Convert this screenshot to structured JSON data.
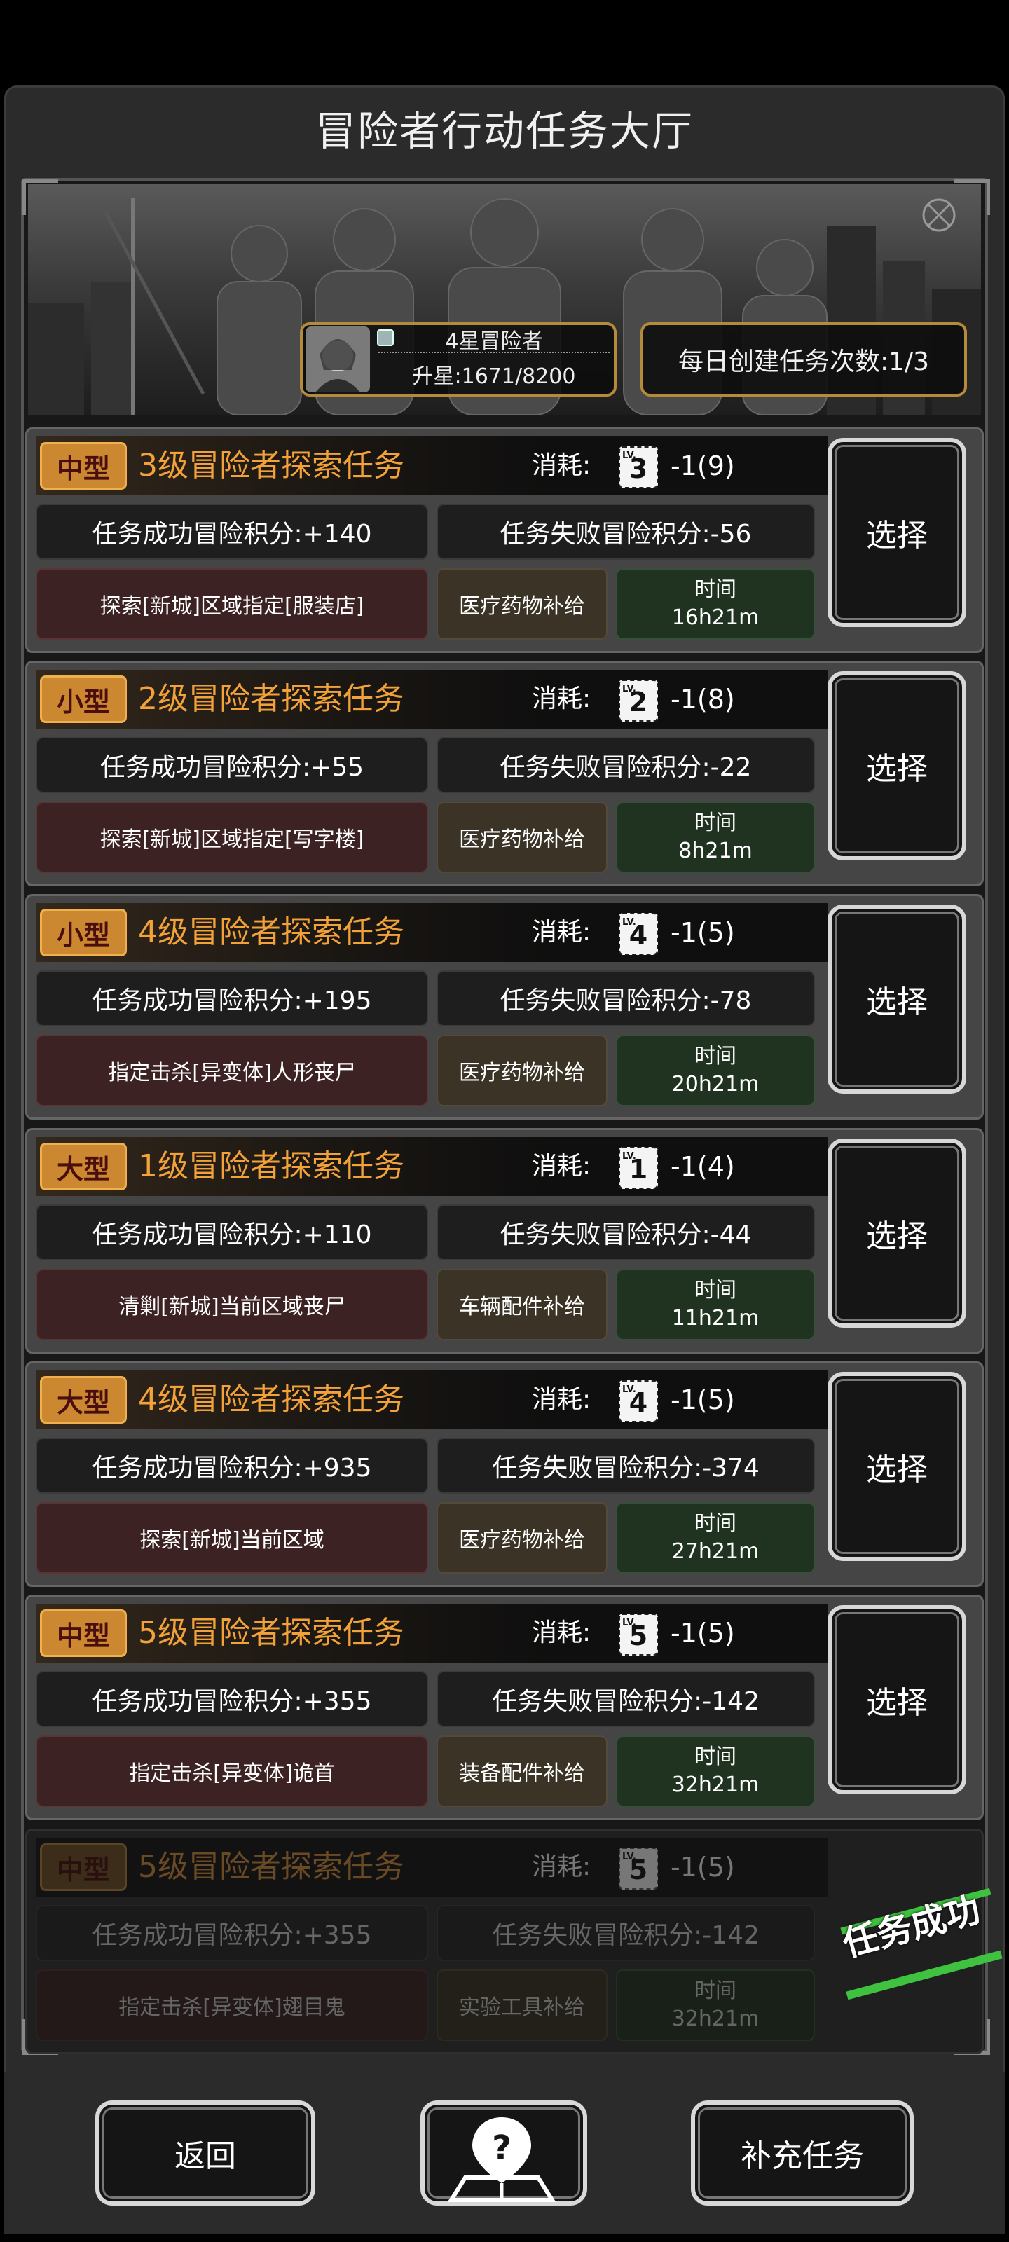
{
  "title": "冒险者行动任务大厅",
  "profile": {
    "rank": "4星冒险者",
    "upgrade": "升星:1671/8200"
  },
  "daily": "每日创建任务次数:1/3",
  "cost_label": "消耗:",
  "select_label": "选择",
  "time_label": "时间",
  "missions": [
    {
      "size": "中型",
      "title": "3级冒险者探索任务",
      "level": "3",
      "cost": "-1(9)",
      "success": "任务成功冒险积分:+140",
      "fail": "任务失败冒险积分:-56",
      "desc": "探索[新城]区域指定[服装店]",
      "reward": "医疗药物补给",
      "time": "16h21m"
    },
    {
      "size": "小型",
      "title": "2级冒险者探索任务",
      "level": "2",
      "cost": "-1(8)",
      "success": "任务成功冒险积分:+55",
      "fail": "任务失败冒险积分:-22",
      "desc": "探索[新城]区域指定[写字楼]",
      "reward": "医疗药物补给",
      "time": "8h21m"
    },
    {
      "size": "小型",
      "title": "4级冒险者探索任务",
      "level": "4",
      "cost": "-1(5)",
      "success": "任务成功冒险积分:+195",
      "fail": "任务失败冒险积分:-78",
      "desc": "指定击杀[异变体]人形丧尸",
      "reward": "医疗药物补给",
      "time": "20h21m"
    },
    {
      "size": "大型",
      "title": "1级冒险者探索任务",
      "level": "1",
      "cost": "-1(4)",
      "success": "任务成功冒险积分:+110",
      "fail": "任务失败冒险积分:-44",
      "desc": "清剿[新城]当前区域丧尸",
      "reward": "车辆配件补给",
      "time": "11h21m"
    },
    {
      "size": "大型",
      "title": "4级冒险者探索任务",
      "level": "4",
      "cost": "-1(5)",
      "success": "任务成功冒险积分:+935",
      "fail": "任务失败冒险积分:-374",
      "desc": "探索[新城]当前区域",
      "reward": "医疗药物补给",
      "time": "27h21m"
    },
    {
      "size": "中型",
      "title": "5级冒险者探索任务",
      "level": "5",
      "cost": "-1(5)",
      "success": "任务成功冒险积分:+355",
      "fail": "任务失败冒险积分:-142",
      "desc": "指定击杀[异变体]诡首",
      "reward": "装备配件补给",
      "time": "32h21m"
    },
    {
      "size": "中型",
      "title": "5级冒险者探索任务",
      "level": "5",
      "cost": "-1(5)",
      "success": "任务成功冒险积分:+355",
      "fail": "任务失败冒险积分:-142",
      "desc": "指定击杀[异变体]翅目鬼",
      "reward": "实验工具补给",
      "time": "32h21m"
    }
  ],
  "completed_stamp": "任务成功",
  "bottom": {
    "back": "返回",
    "supplement": "补充任务"
  },
  "colors": {
    "accent": "#f3a23a",
    "tag": "#cc8830",
    "frame_gold": "#b58a3a",
    "stamp_green": "#3fc23f"
  }
}
